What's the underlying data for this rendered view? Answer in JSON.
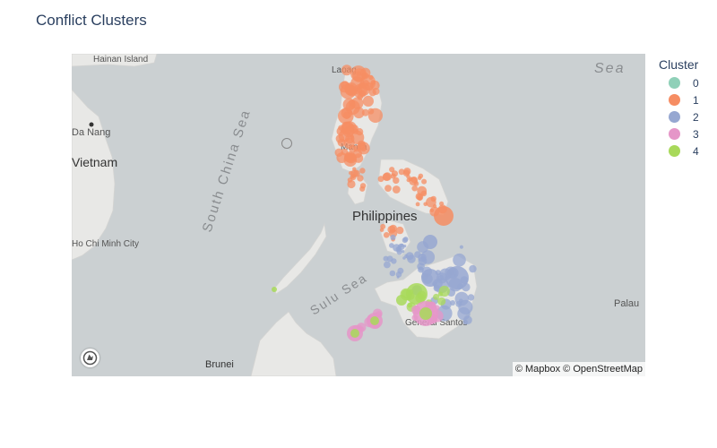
{
  "title": "Conflict Clusters",
  "legend": {
    "title": "Cluster",
    "items": [
      {
        "label": "0",
        "color": "#8fd0b8"
      },
      {
        "label": "1",
        "color": "#f68d63"
      },
      {
        "label": "2",
        "color": "#96a7d1"
      },
      {
        "label": "3",
        "color": "#e596c8"
      },
      {
        "label": "4",
        "color": "#a8d95a"
      }
    ]
  },
  "map": {
    "labels": {
      "hainan": "Hainan Island",
      "danang": "Da Nang",
      "vietnam": "Vietnam",
      "hcmc": "Ho Chi Minh City",
      "south_china_sea": "South China Sea",
      "sea": "Sea",
      "laoag": "Laoag",
      "manila": "Manila",
      "philippines": "Philippines",
      "sulu_sea": "Sulu Sea",
      "gensan": "General Santos",
      "palau": "Palau",
      "brunei": "Brunei"
    },
    "attribution": "© Mapbox © OpenStreetMap",
    "logo_icon": "mapbox-logo-icon",
    "colors": {
      "water": "#cbd0d2",
      "land": "#e8e8e6"
    }
  }
}
